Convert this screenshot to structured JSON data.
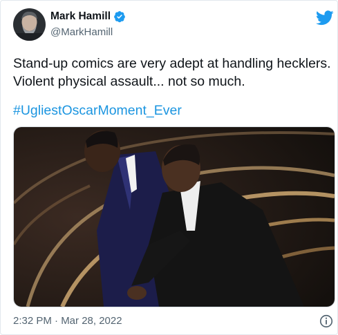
{
  "tweet": {
    "author_name": "Mark Hamill",
    "author_handle": "@MarkHamill",
    "text": "Stand-up comics are very adept at handling hecklers. Violent physical assault... not so much.",
    "hashtag": "#UgliestOscarMoment_Ever",
    "timestamp": "2:32 PM · Mar 28, 2022",
    "icons": [
      "verified-badge-icon",
      "twitter-bird-icon",
      "info-icon"
    ],
    "accent_color": "#1d9bf0",
    "hashtag_color": "#1b95e0"
  }
}
